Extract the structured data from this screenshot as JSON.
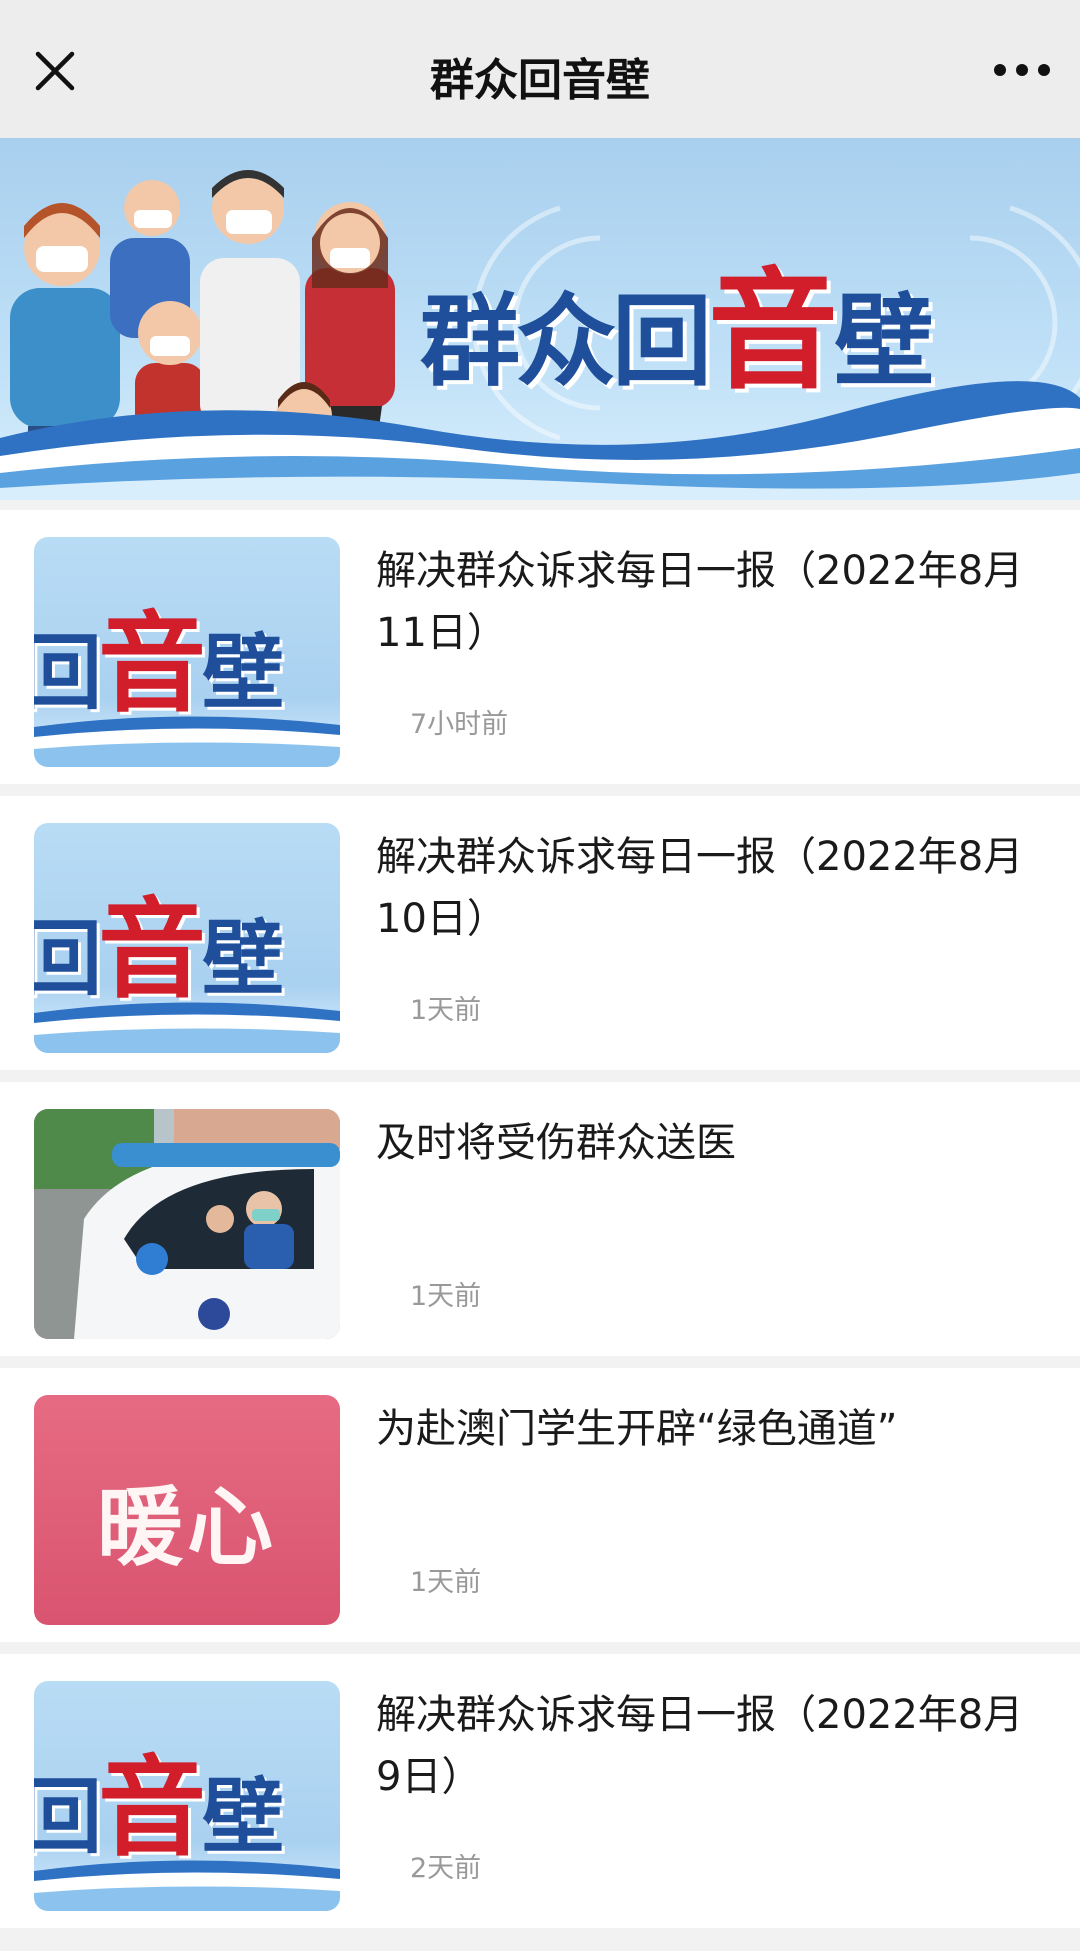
{
  "nav": {
    "title": "群众回音壁",
    "close_icon": "close-icon",
    "more_icon": "more-horizontal-icon"
  },
  "banner": {
    "title_part1": "群众回",
    "title_red": "音",
    "title_part2": "壁"
  },
  "thumbs": {
    "echo_left": "回",
    "echo_red": "音",
    "echo_right": "壁",
    "warm": "暖心"
  },
  "articles": [
    {
      "title": "解决群众诉求每日一报（2022年8月11日）",
      "time": "7小时前"
    },
    {
      "title": "解决群众诉求每日一报（2022年8月10日）",
      "time": "1天前"
    },
    {
      "title": "及时将受伤群众送医",
      "time": "1天前"
    },
    {
      "title": "为赴澳门学生开辟“绿色通道”",
      "time": "1天前"
    },
    {
      "title": "解决群众诉求每日一报（2022年8月9日）",
      "time": "2天前"
    }
  ],
  "colors": {
    "brand_blue": "#1f4e9b",
    "brand_red": "#d21e2b",
    "warm_pink": "#d95470"
  }
}
